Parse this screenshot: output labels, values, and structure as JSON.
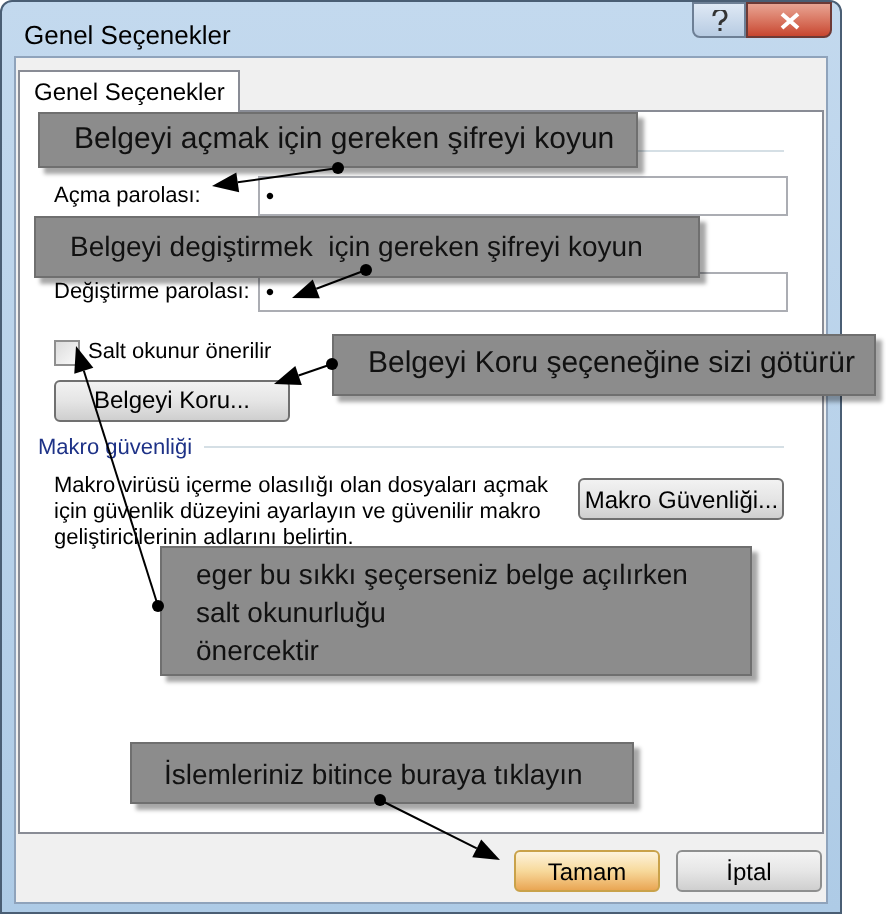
{
  "window": {
    "title": "Genel Seçenekler"
  },
  "tabs": [
    {
      "label": "Genel Seçenekler",
      "selected": true
    }
  ],
  "fields": [
    {
      "label": "Açma parolası:",
      "value": "•"
    },
    {
      "label": "Değiştirme parolası:",
      "value": "•"
    }
  ],
  "checkbox": {
    "label": "Salt okunur önerilir",
    "checked": false
  },
  "protect_button": "Belgeyi Koru...",
  "macro_section": {
    "title": "Makro güvenliği",
    "description": "Makro virüsü içerme olasılığı olan dosyaları açmak için güvenlik düzeyini ayarlayın ve güvenilir makro geliştiricilerinin adlarını belirtin.",
    "button": "Makro Güvenliği..."
  },
  "callouts": [
    {
      "lines": [
        "Belgeyi açmak için gereken şifreyi koyun"
      ]
    },
    {
      "lines": [
        "Belgeyi degiştirmek  için gereken şifreyi koyun"
      ]
    },
    {
      "lines": [
        "Belgeyi Koru şeçeneğine sizi götürür"
      ]
    },
    {
      "lines": [
        "eger bu sıkkı şeçerseniz belge açılırken",
        "salt okunurluğu",
        "önercektir"
      ]
    },
    {
      "lines": [
        "İslemleriniz bitince buraya tıklayın"
      ]
    }
  ],
  "buttons": [
    {
      "label": "Tamam",
      "kind": "default"
    },
    {
      "label": "İptal",
      "kind": "normal"
    }
  ]
}
